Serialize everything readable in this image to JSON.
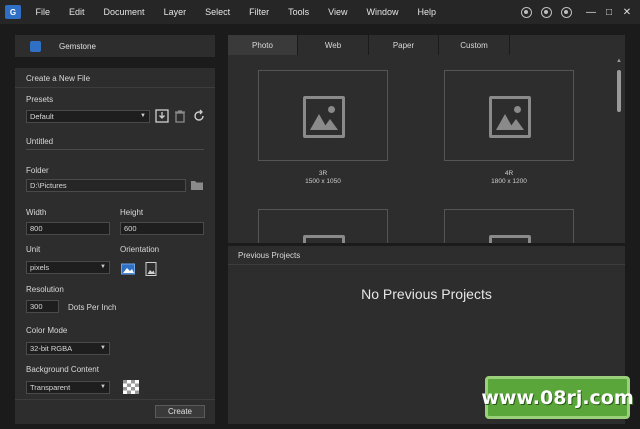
{
  "menubar": {
    "items": [
      "File",
      "Edit",
      "Document",
      "Layer",
      "Select",
      "Filter",
      "Tools",
      "View",
      "Window",
      "Help"
    ],
    "window_controls": [
      "minimize-icon",
      "maximize-icon",
      "close-icon"
    ],
    "extra_icons": [
      "globe-icon",
      "bell-icon",
      "user-icon"
    ]
  },
  "left_header": {
    "title": "Gemstone"
  },
  "new_file": {
    "section_title": "Create a New File",
    "presets_label": "Presets",
    "preset_value": "Default",
    "name_value": "Untitled",
    "folder_label": "Folder",
    "folder_value": "D:\\Pictures",
    "width_label": "Width",
    "width_value": "800",
    "height_label": "Height",
    "height_value": "600",
    "unit_label": "Unit",
    "unit_value": "pixels",
    "orientation_label": "Orientation",
    "resolution_label": "Resolution",
    "resolution_value": "300",
    "resolution_unit": "Dots Per Inch",
    "color_mode_label": "Color Mode",
    "color_mode_value": "32-bit RGBA",
    "background_label": "Background Content",
    "background_value": "Transparent",
    "create_label": "Create"
  },
  "tabs": {
    "items": [
      "Photo",
      "Web",
      "Paper",
      "Custom"
    ],
    "active": "Photo"
  },
  "presets": [
    {
      "name": "3R",
      "size": "1500 x 1050"
    },
    {
      "name": "4R",
      "size": "1800 x 1200"
    },
    {
      "name": "",
      "size": ""
    },
    {
      "name": "",
      "size": ""
    }
  ],
  "previous_projects": {
    "title": "Previous Projects",
    "empty_message": "No Previous Projects"
  },
  "watermark": {
    "text": "www.08rj.com"
  },
  "colors": {
    "background": "#1b1b1b",
    "panel": "#2d2d2d",
    "accent": "#2f6fc4",
    "watermark": "#5aa63a"
  }
}
